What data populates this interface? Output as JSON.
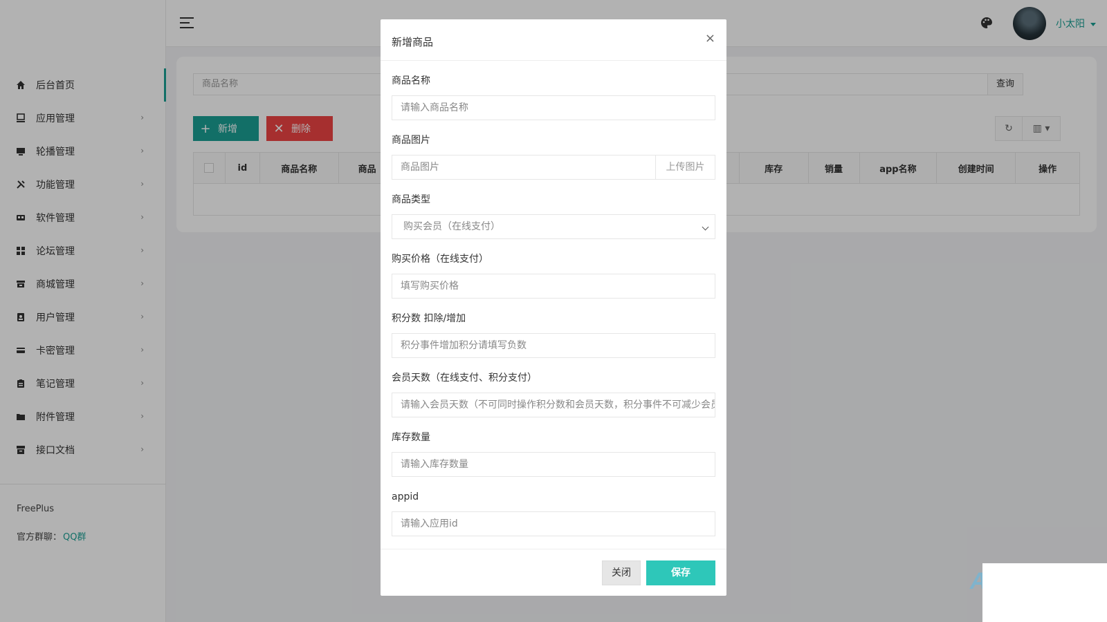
{
  "sidebar": {
    "items": [
      {
        "label": "后台首页",
        "icon": "home-icon"
      },
      {
        "label": "应用管理",
        "icon": "monitor-icon"
      },
      {
        "label": "轮播管理",
        "icon": "carousel-icon"
      },
      {
        "label": "功能管理",
        "icon": "tools-icon"
      },
      {
        "label": "软件管理",
        "icon": "software-icon"
      },
      {
        "label": "论坛管理",
        "icon": "grid-icon"
      },
      {
        "label": "商城管理",
        "icon": "shop-icon"
      },
      {
        "label": "用户管理",
        "icon": "user-badge-icon"
      },
      {
        "label": "卡密管理",
        "icon": "card-icon"
      },
      {
        "label": "笔记管理",
        "icon": "clipboard-icon"
      },
      {
        "label": "附件管理",
        "icon": "folder-icon"
      },
      {
        "label": "接口文档",
        "icon": "archive-icon"
      }
    ],
    "footer": {
      "brand": "FreePlus",
      "group_label": "官方群聊：",
      "group_link": "QQ群"
    }
  },
  "topbar": {
    "username": "小太阳"
  },
  "list": {
    "search_placeholder": "商品名称",
    "search_button": "查询",
    "add_button": "新增",
    "delete_button": "删除",
    "columns": [
      "id",
      "商品名称",
      "商品",
      "库存",
      "销量",
      "app名称",
      "创建时间",
      "操作"
    ]
  },
  "modal": {
    "title": "新增商品",
    "fields": {
      "name": {
        "label": "商品名称",
        "placeholder": "请输入商品名称"
      },
      "image": {
        "label": "商品图片",
        "placeholder": "商品图片",
        "button": "上传图片"
      },
      "type": {
        "label": "商品类型",
        "value": "购买会员（在线支付）"
      },
      "price": {
        "label": "购买价格（在线支付）",
        "placeholder": "填写购买价格"
      },
      "points": {
        "label": "积分数 扣除/增加",
        "placeholder": "积分事件增加积分请填写负数"
      },
      "vip_days": {
        "label": "会员天数（在线支付、积分支付）",
        "placeholder": "请输入会员天数（不可同时操作积分数和会员天数，积分事件不可减少会员天数）"
      },
      "stock": {
        "label": "库存数量",
        "placeholder": "请输入库存数量"
      },
      "appid": {
        "label": "appid",
        "placeholder": "请输入应用id"
      }
    },
    "close_button": "关闭",
    "save_button": "保存"
  },
  "colors": {
    "accent": "#1aa094",
    "danger": "#ee4444",
    "save": "#2ec7b9"
  }
}
